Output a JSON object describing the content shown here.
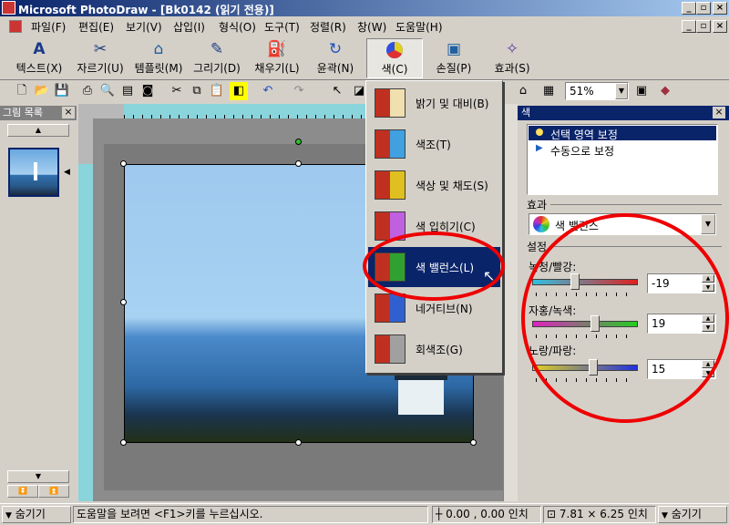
{
  "window": {
    "title": "Microsoft PhotoDraw - [Bk0142 (읽기 전용)]"
  },
  "menu": [
    "파일(F)",
    "편집(E)",
    "보기(V)",
    "삽입(I)",
    "형식(O)",
    "도구(T)",
    "정렬(R)",
    "창(W)",
    "도움말(H)"
  ],
  "bigbar": [
    {
      "label": "텍스트(X)",
      "icon": "text-icon"
    },
    {
      "label": "자르기(U)",
      "icon": "scissors-icon"
    },
    {
      "label": "템플릿(M)",
      "icon": "template-icon"
    },
    {
      "label": "그리기(D)",
      "icon": "pen-icon"
    },
    {
      "label": "채우기(L)",
      "icon": "paint-bucket-icon"
    },
    {
      "label": "윤곽(N)",
      "icon": "outline-icon"
    },
    {
      "label": "색(C)",
      "icon": "color-wheel-icon"
    },
    {
      "label": "손질(P)",
      "icon": "touchup-icon"
    },
    {
      "label": "효과(S)",
      "icon": "effects-icon"
    }
  ],
  "toolbar": {
    "zoom": "51%"
  },
  "leftpanel": {
    "title": "그림 목록"
  },
  "color_menu": [
    {
      "label": "밝기 및 대비(B)"
    },
    {
      "label": "색조(T)"
    },
    {
      "label": "색상 및 채도(S)"
    },
    {
      "label": "색 입히기(C)"
    },
    {
      "label": "색 밸런스(L)"
    },
    {
      "label": "네거티브(N)"
    },
    {
      "label": "회색조(G)"
    }
  ],
  "rightpanel": {
    "title": "색",
    "options": [
      "선택 영역 보정",
      "수동으로 보정"
    ],
    "effect_label": "효과",
    "effect_value": "색 밸런스",
    "settings_label": "설정",
    "sliders": [
      {
        "label": "녹청/빨강:",
        "value": "-19",
        "level": -19
      },
      {
        "label": "자홍/녹색:",
        "value": "19",
        "level": 19
      },
      {
        "label": "노랑/파랑:",
        "value": "15",
        "level": 15
      }
    ]
  },
  "status": {
    "toggle_left": "숨기기",
    "help": "도움말을 보려면 <F1>키를 누르십시오.",
    "coords": "0.00 , 0.00 인치",
    "size": "7.81 × 6.25 인치",
    "toggle_right": "숨기기"
  },
  "colors": {
    "title_start": "#0a246a",
    "title_end": "#a6caf0",
    "highlight": "#0a246a",
    "annotation": "#e00000",
    "ruler": "#8ad4dc"
  }
}
